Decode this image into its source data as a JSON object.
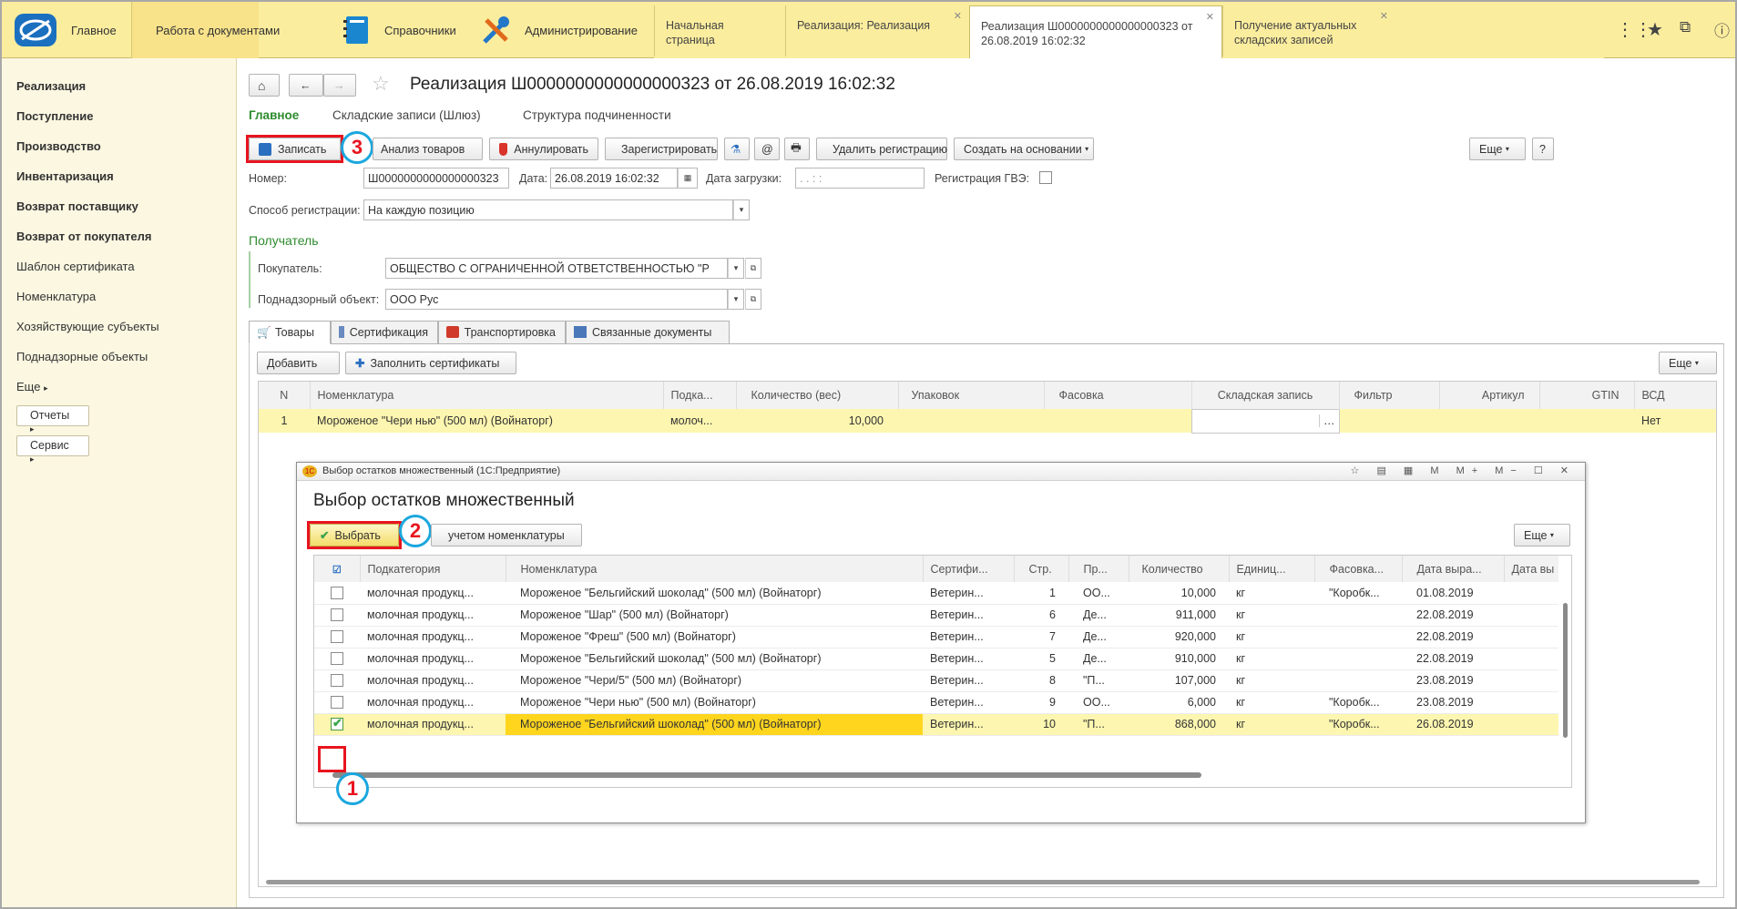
{
  "topbar": {
    "logo_label": "Главное",
    "sections": [
      {
        "label": "Работа с документами",
        "icon": "briefcase-icon"
      },
      {
        "label": "Справочники",
        "icon": "book-icon"
      },
      {
        "label": "Администрирование",
        "icon": "tools-icon"
      }
    ],
    "tabs": [
      {
        "label": "Начальная страница",
        "closable": false
      },
      {
        "label": "Реализация: Реализация",
        "closable": true
      },
      {
        "label": "Реализация Ш0000000000000000323 от 26.08.2019 16:02:32",
        "closable": true,
        "active": true
      },
      {
        "label": "Получение актуальных складских записей",
        "closable": true
      }
    ],
    "right_icons": [
      "grid-icon",
      "star-icon",
      "copy-window-icon",
      "info-icon"
    ]
  },
  "sidebar": {
    "items": [
      {
        "label": "Реализация",
        "bold": true
      },
      {
        "label": "Поступление",
        "bold": true
      },
      {
        "label": "Производство",
        "bold": true
      },
      {
        "label": "Инвентаризация",
        "bold": true
      },
      {
        "label": "Возврат поставщику",
        "bold": true
      },
      {
        "label": "Возврат от покупателя",
        "bold": true
      },
      {
        "label": "Шаблон сертификата",
        "bold": false
      },
      {
        "label": "Номенклатура",
        "bold": false
      },
      {
        "label": "Хозяйствующие субъекты",
        "bold": false
      },
      {
        "label": "Поднадзорные объекты",
        "bold": false
      },
      {
        "label": "Еще",
        "bold": false
      }
    ],
    "reports_label": "Отчеты",
    "service_label": "Сервис"
  },
  "doc": {
    "title": "Реализация Ш0000000000000000323 от 26.08.2019 16:02:32",
    "nav_tabs": [
      "Главное",
      "Складские записи (Шлюз)",
      "Структура подчиненности"
    ],
    "toolbar": {
      "save": "Записать",
      "analysis": "Анализ товаров",
      "annul": "Аннулировать",
      "register": "Зарегистрировать",
      "email": "@",
      "delete_reg": "Удалить регистрацию",
      "create_based": "Создать на основании",
      "more": "Еще",
      "help": "?"
    },
    "fields": {
      "number_label": "Номер:",
      "number": "Ш0000000000000000323",
      "date_label": "Дата:",
      "date": "26.08.2019 16:02:32",
      "load_date_label": "Дата загрузки:",
      "load_date": ".  .       :  :",
      "gvz_label": "Регистрация ГВЭ:",
      "reg_method_label": "Способ регистрации:",
      "reg_method": "На каждую позицию",
      "recipient_header": "Получатель",
      "buyer_label": "Покупатель:",
      "buyer": "ОБЩЕСТВО С ОГРАНИЧЕННОЙ ОТВЕТСТВЕННОСТЬЮ \"Р",
      "object_label": "Поднадзорный объект:",
      "object": "ООО Рус"
    },
    "tabs": [
      "Товары",
      "Сертификация",
      "Транспортировка",
      "Связанные документы"
    ],
    "goods_toolbar": {
      "add": "Добавить",
      "fill_certs": "Заполнить сертификаты",
      "more": "Еще"
    },
    "goods_table": {
      "headers": [
        "N",
        "Номенклатура",
        "Подка...",
        "Количество (вес)",
        "Упаковок",
        "Фасовка",
        "Складская запись",
        "Фильтр",
        "Артикул",
        "GTIN",
        "ВСД"
      ],
      "rows": [
        {
          "n": "1",
          "name": "Мороженое \"Чери нью\" (500 мл) (Войнаторг)",
          "sub": "молоч...",
          "qty": "10,000",
          "pack": "",
          "fas": "",
          "record": "",
          "filter": "",
          "art": "",
          "gtin": "",
          "vsd": "Нет"
        }
      ]
    }
  },
  "dialog": {
    "window_title": "Выбор остатков множественный (1С:Предприятие)",
    "title": "Выбор остатков множественный",
    "select_btn": "Выбрать",
    "filter_btn": "учетом номенклатуры",
    "more": "Еще",
    "headers": [
      "Подкатегория",
      "Номенклатура",
      "Сертифи...",
      "Стр.",
      "Пр...",
      "Количество",
      "Единиц...",
      "Фасовка...",
      "Дата выра...",
      "Дата вы"
    ],
    "rows": [
      {
        "checked": false,
        "sub": "молочная продукц...",
        "name": "Мороженое \"Бельгийский шоколад\" (500 мл) (Войнаторг)",
        "cert": "Ветерин...",
        "str": "1",
        "pr": "ОО...",
        "qty": "10,000",
        "unit": "кг",
        "fas": "\"Коробк...",
        "date": "01.08.2019"
      },
      {
        "checked": false,
        "sub": "молочная продукц...",
        "name": "Мороженое \"Шар\" (500 мл) (Войнаторг)",
        "cert": "Ветерин...",
        "str": "6",
        "pr": "Де...",
        "qty": "911,000",
        "unit": "кг",
        "fas": "",
        "date": "22.08.2019"
      },
      {
        "checked": false,
        "sub": "молочная продукц...",
        "name": "Мороженое \"Фреш\" (500 мл) (Войнаторг)",
        "cert": "Ветерин...",
        "str": "7",
        "pr": "Де...",
        "qty": "920,000",
        "unit": "кг",
        "fas": "",
        "date": "22.08.2019"
      },
      {
        "checked": false,
        "sub": "молочная продукц...",
        "name": "Мороженое \"Бельгийский шоколад\" (500 мл) (Войнаторг)",
        "cert": "Ветерин...",
        "str": "5",
        "pr": "Де...",
        "qty": "910,000",
        "unit": "кг",
        "fas": "",
        "date": "22.08.2019"
      },
      {
        "checked": false,
        "sub": "молочная продукц...",
        "name": "Мороженое \"Чери/5\" (500 мл) (Войнаторг)",
        "cert": "Ветерин...",
        "str": "8",
        "pr": "\"П...",
        "qty": "107,000",
        "unit": "кг",
        "fas": "",
        "date": "23.08.2019"
      },
      {
        "checked": false,
        "sub": "молочная продукц...",
        "name": "Мороженое \"Чери нью\" (500 мл) (Войнаторг)",
        "cert": "Ветерин...",
        "str": "9",
        "pr": "ОО...",
        "qty": "6,000",
        "unit": "кг",
        "fas": "\"Коробк...",
        "date": "23.08.2019"
      },
      {
        "checked": true,
        "sub": "молочная продукц...",
        "name": "Мороженое \"Бельгийский шоколад\" (500 мл) (Войнаторг)",
        "cert": "Ветерин...",
        "str": "10",
        "pr": "\"П...",
        "qty": "868,000",
        "unit": "кг",
        "fas": "\"Коробк...",
        "date": "26.08.2019"
      }
    ]
  },
  "annotations": {
    "step1": "1",
    "step2": "2",
    "step3": "3"
  },
  "colors": {
    "accent_yellow": "#fbed9e",
    "highlight_row": "#fdf6b0",
    "selected_cell": "#ffd51e",
    "annotation_red": "#e8141e",
    "annotation_blue": "#1ba7de",
    "green_link": "#2e8b2e"
  }
}
